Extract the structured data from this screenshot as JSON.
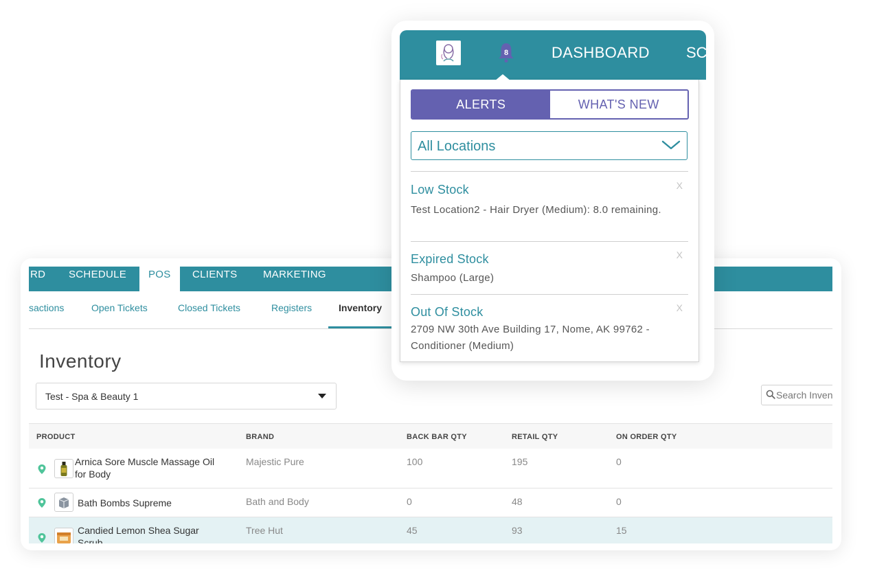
{
  "inventory_panel": {
    "nav": {
      "items": [
        "RD",
        "SCHEDULE",
        "POS",
        "CLIENTS",
        "MARKETING"
      ],
      "active": "POS"
    },
    "subnav": {
      "items": [
        "sactions",
        "Open Tickets",
        "Closed Tickets",
        "Registers",
        "Inventory"
      ],
      "active": "Inventory"
    },
    "title": "Inventory",
    "location_select": "Test - Spa & Beauty 1",
    "search_placeholder": "Search Inven",
    "table": {
      "columns": [
        "PRODUCT",
        "BRAND",
        "BACK BAR QTY",
        "RETAIL QTY",
        "ON ORDER QTY"
      ],
      "rows": [
        {
          "product": "Arnica Sore Muscle Massage Oil for Body",
          "brand": "Majestic Pure",
          "back_bar_qty": "100",
          "retail_qty": "195",
          "on_order_qty": "0",
          "thumb_icon": "oil-bottle-icon"
        },
        {
          "product": "Bath Bombs Supreme",
          "brand": "Bath and Body",
          "back_bar_qty": "0",
          "retail_qty": "48",
          "on_order_qty": "0",
          "thumb_icon": "box-icon"
        },
        {
          "product": "Candied Lemon Shea Sugar Scrub",
          "brand": "Tree Hut",
          "back_bar_qty": "45",
          "retail_qty": "93",
          "on_order_qty": "15",
          "thumb_icon": "jar-icon"
        }
      ]
    }
  },
  "alerts_popup": {
    "nav": {
      "badge_count": "8",
      "dashboard_label": "DASHBOARD",
      "next_label": "SC"
    },
    "tabs": {
      "alerts": "ALERTS",
      "whats_new": "WHAT'S NEW",
      "active": "ALERTS"
    },
    "location_dropdown": "All Locations",
    "close_label": "X",
    "alerts": [
      {
        "title": "Low Stock",
        "body": "Test Location2 - Hair Dryer (Medium): 8.0 remaining."
      },
      {
        "title": "Expired Stock",
        "body": "Shampoo (Large)"
      },
      {
        "title": "Out Of Stock",
        "body": "2709 NW 30th Ave Building 17, Nome, AK 99762 - Conditioner (Medium)"
      }
    ]
  },
  "colors": {
    "teal": "#2e8e9f",
    "purple": "#6461b0",
    "selected_row": "#e4f2f4",
    "pin_green": "#4fc49a"
  }
}
